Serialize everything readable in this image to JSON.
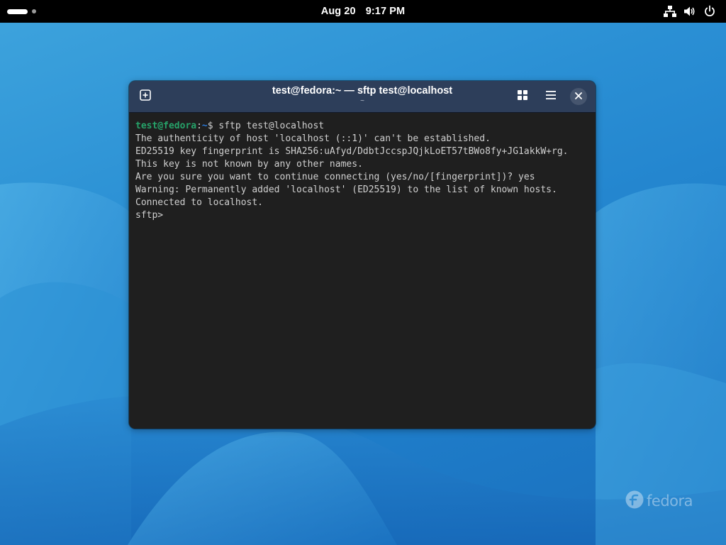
{
  "topbar": {
    "date": "Aug 20",
    "time": "9:17 PM",
    "icons": [
      "network-wired-icon",
      "volume-icon",
      "power-icon"
    ]
  },
  "window": {
    "title": "test@fedora:~ — sftp test@localhost",
    "subtitle": "~",
    "headerbar_color": "#2d3e5a",
    "buttons": {
      "new_tab_icon": "new-tab-icon",
      "grid_icon": "tab-overview-icon",
      "menu_icon": "hamburger-menu-icon",
      "close_icon": "close-icon"
    }
  },
  "terminal": {
    "background": "#1f1f1f",
    "prompt_user": "test@fedora",
    "prompt_sep": ":",
    "prompt_path": "~",
    "prompt_symbol": "$ ",
    "command": "sftp test@localhost",
    "output": [
      "The authenticity of host 'localhost (::1)' can't be established.",
      "ED25519 key fingerprint is SHA256:uAfyd/DdbtJccspJQjkLoET57tBWo8fy+JG1akkW+rg.",
      "This key is not known by any other names.",
      "Are you sure you want to continue connecting (yes/no/[fingerprint])? yes",
      "Warning: Permanently added 'localhost' (ED25519) to the list of known hosts.",
      "Connected to localhost.",
      "sftp>"
    ]
  },
  "desktop": {
    "watermark": "fedora"
  }
}
